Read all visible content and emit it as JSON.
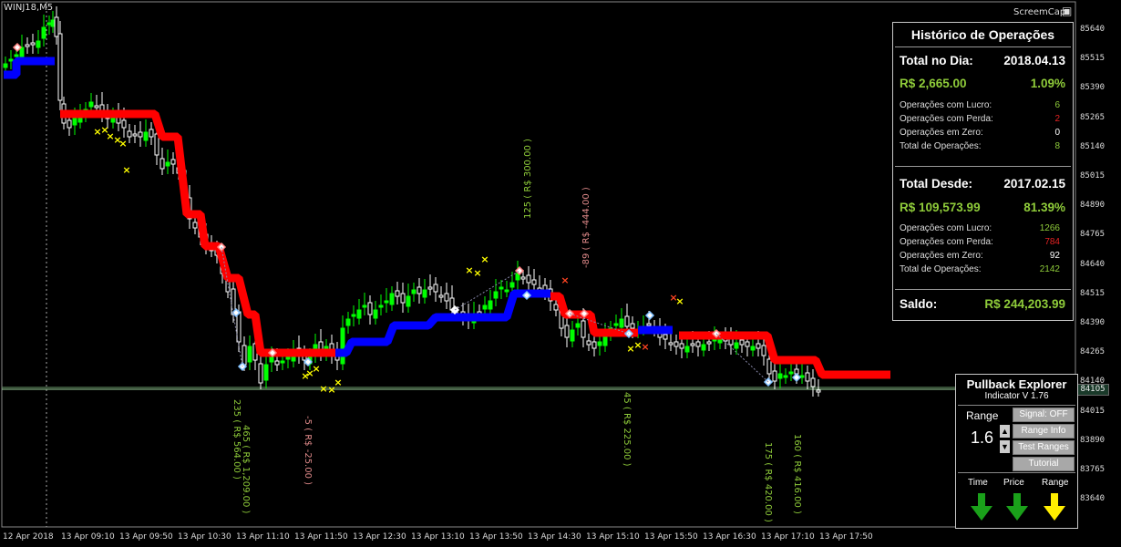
{
  "chart": {
    "symbol": "WINJ18,M5",
    "screemcap_label": "ScreemCap",
    "current_price": "84105",
    "y_labels": [
      "85640",
      "85515",
      "85390",
      "85265",
      "85140",
      "85015",
      "84890",
      "84765",
      "84640",
      "84515",
      "84390",
      "84265",
      "84140",
      "84015",
      "83890",
      "83765",
      "83640"
    ],
    "x_labels": [
      "12 Apr 2018",
      "13 Apr 09:10",
      "13 Apr 09:50",
      "13 Apr 10:30",
      "13 Apr 11:10",
      "13 Apr 11:50",
      "13 Apr 12:30",
      "13 Apr 13:10",
      "13 Apr 13:50",
      "13 Apr 14:30",
      "13 Apr 15:10",
      "13 Apr 15:50",
      "13 Apr 16:30",
      "13 Apr 17:10",
      "13 Apr 17:50"
    ],
    "trade_labels": [
      {
        "text": "235 ( R$ 564.00 )",
        "color": "#8fcc3a"
      },
      {
        "text": "465 ( R$ 1,209.00 )",
        "color": "#8fcc3a"
      },
      {
        "text": "-5 ( R$ -25.00 )",
        "color": "#e08a8a"
      },
      {
        "text": "125 ( R$ 300.00 )",
        "color": "#8fcc3a"
      },
      {
        "text": "-89 ( R$ -444.00 )",
        "color": "#e08a8a"
      },
      {
        "text": "45 ( R$ 225.00 )",
        "color": "#8fcc3a"
      },
      {
        "text": "175 ( R$ 420.00 )",
        "color": "#8fcc3a"
      },
      {
        "text": "160 ( R$ 416.00 )",
        "color": "#8fcc3a"
      }
    ],
    "colors": {
      "bull": "#00ff00",
      "bear": "#ffffff",
      "band_up": "#0000ff",
      "band_down": "#ff0000",
      "marker": "#ffff00",
      "grid": "#555"
    }
  },
  "history": {
    "title": "Histórico de Operações",
    "day_label": "Total no Dia:",
    "day_date": "2018.04.13",
    "day_amount": "R$ 2,665.00",
    "day_pct": "1.09%",
    "day_rows": [
      {
        "label": "Operações com Lucro:",
        "value": "6",
        "color": "green"
      },
      {
        "label": "Operações com Perda:",
        "value": "2",
        "color": "red"
      },
      {
        "label": "Operações em Zero:",
        "value": "0",
        "color": "white"
      },
      {
        "label": "Total de Operações:",
        "value": "8",
        "color": "green"
      }
    ],
    "since_label": "Total Desde:",
    "since_date": "2017.02.15",
    "since_amount": "R$ 109,573.99",
    "since_pct": "81.39%",
    "since_rows": [
      {
        "label": "Operações com Lucro:",
        "value": "1266",
        "color": "green"
      },
      {
        "label": "Operações com Perda:",
        "value": "784",
        "color": "red"
      },
      {
        "label": "Operações em Zero:",
        "value": "92",
        "color": "white"
      },
      {
        "label": "Total de Operações:",
        "value": "2142",
        "color": "green"
      }
    ],
    "balance_label": "Saldo:",
    "balance_value": "R$ 244,203.99"
  },
  "pullback": {
    "title": "Pullback Explorer",
    "subtitle": "Indicator V 1.76",
    "range_label": "Range",
    "range_value": "1.6",
    "buttons": [
      "Signal: OFF",
      "Range Info",
      "Test Ranges",
      "Tutorial"
    ],
    "columns": [
      "Time",
      "Price",
      "Range"
    ],
    "column_icons": [
      "arrow-down-green-icon",
      "arrow-down-green-icon",
      "arrow-down-yellow-icon"
    ]
  }
}
